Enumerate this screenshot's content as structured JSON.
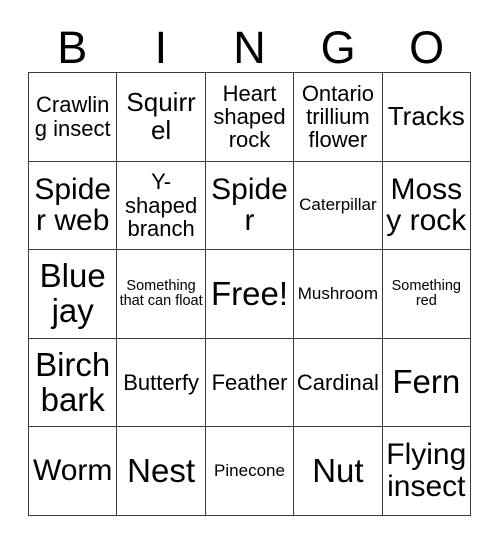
{
  "card": {
    "title": "Bingo Card",
    "header_letters": [
      "B",
      "I",
      "N",
      "G",
      "O"
    ],
    "free_space_label": "Free!",
    "colors": {
      "background": "#ffffff",
      "text": "#000000",
      "grid_line": "#3c3c3c"
    },
    "grid": {
      "columns": 5,
      "rows": 5,
      "cells": [
        [
          {
            "label": "Crawling insect",
            "size": "md"
          },
          {
            "label": "Squirrel",
            "size": "lg"
          },
          {
            "label": "Heart shaped rock",
            "size": "md"
          },
          {
            "label": "Ontario trillium flower",
            "size": "md"
          },
          {
            "label": "Tracks",
            "size": "lg"
          }
        ],
        [
          {
            "label": "Spider web",
            "size": "xl"
          },
          {
            "label": "Y-shaped branch",
            "size": "md"
          },
          {
            "label": "Spider",
            "size": "xl"
          },
          {
            "label": "Caterpillar",
            "size": "sm"
          },
          {
            "label": "Mossy rock",
            "size": "xl"
          }
        ],
        [
          {
            "label": "Blue jay",
            "size": "xxl"
          },
          {
            "label": "Something that can float",
            "size": "xs"
          },
          {
            "label": "Free!",
            "size": "xxl"
          },
          {
            "label": "Mushroom",
            "size": "sm"
          },
          {
            "label": "Something red",
            "size": "xs"
          }
        ],
        [
          {
            "label": "Birch bark",
            "size": "xxl"
          },
          {
            "label": "Butterfy",
            "size": "md"
          },
          {
            "label": "Feather",
            "size": "md"
          },
          {
            "label": "Cardinal",
            "size": "md"
          },
          {
            "label": "Fern",
            "size": "xxl"
          }
        ],
        [
          {
            "label": "Worm",
            "size": "xl"
          },
          {
            "label": "Nest",
            "size": "xxl"
          },
          {
            "label": "Pinecone",
            "size": "sm"
          },
          {
            "label": "Nut",
            "size": "xxl"
          },
          {
            "label": "Flying insect",
            "size": "xl"
          }
        ]
      ]
    }
  }
}
